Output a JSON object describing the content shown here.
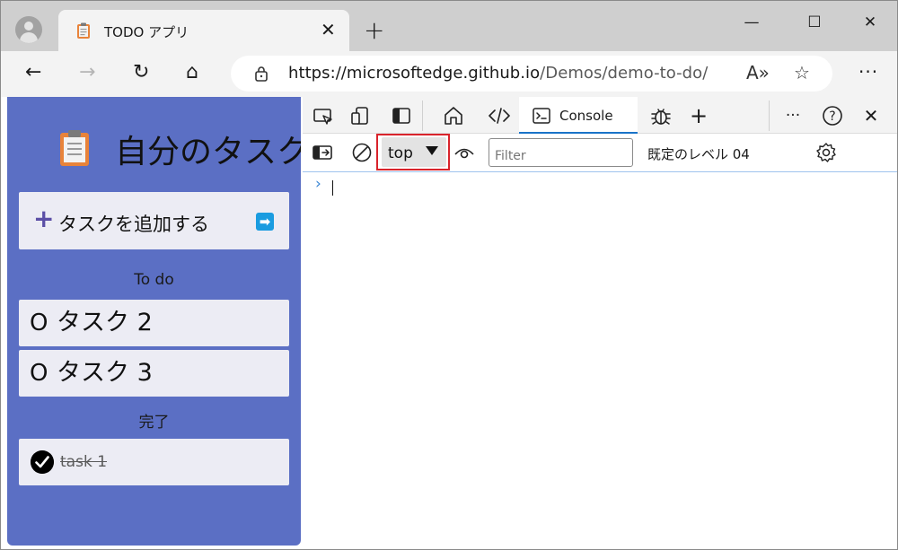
{
  "browser": {
    "tab_title": "TODO アプリ",
    "tab_close": "✕",
    "new_tab": "+",
    "window_controls": {
      "minimize": "—",
      "maximize": "☐",
      "close": "✕"
    },
    "nav": {
      "back": "←",
      "forward": "→",
      "refresh": "↻",
      "home": "⌂"
    },
    "url_host": "https://microsoftedge.github.io",
    "url_path": "/Demos/demo-to-do/",
    "read_aloud": "A»",
    "favorite": "☆",
    "menu": "···"
  },
  "app": {
    "title": "自分のタスク",
    "add_task": {
      "plus": "+",
      "label": "タスクを追加する",
      "arrow": "➡"
    },
    "todo_heading": "To do",
    "todo_items": [
      {
        "mark": "O",
        "text": "タスク 2"
      },
      {
        "mark": "O",
        "text": "タスク 3"
      }
    ],
    "done_heading": "完了",
    "done_items": [
      {
        "text": "task 1"
      }
    ]
  },
  "devtools": {
    "console_tab": "Console",
    "add_tab": "+",
    "more": "···",
    "help": "?",
    "close": "✕",
    "context": "top",
    "filter_placeholder": "Filter",
    "levels": "既定のレベル 04",
    "prompt": "›",
    "colors": {
      "highlight": "#d9232b",
      "accent": "#1a73c8"
    }
  }
}
